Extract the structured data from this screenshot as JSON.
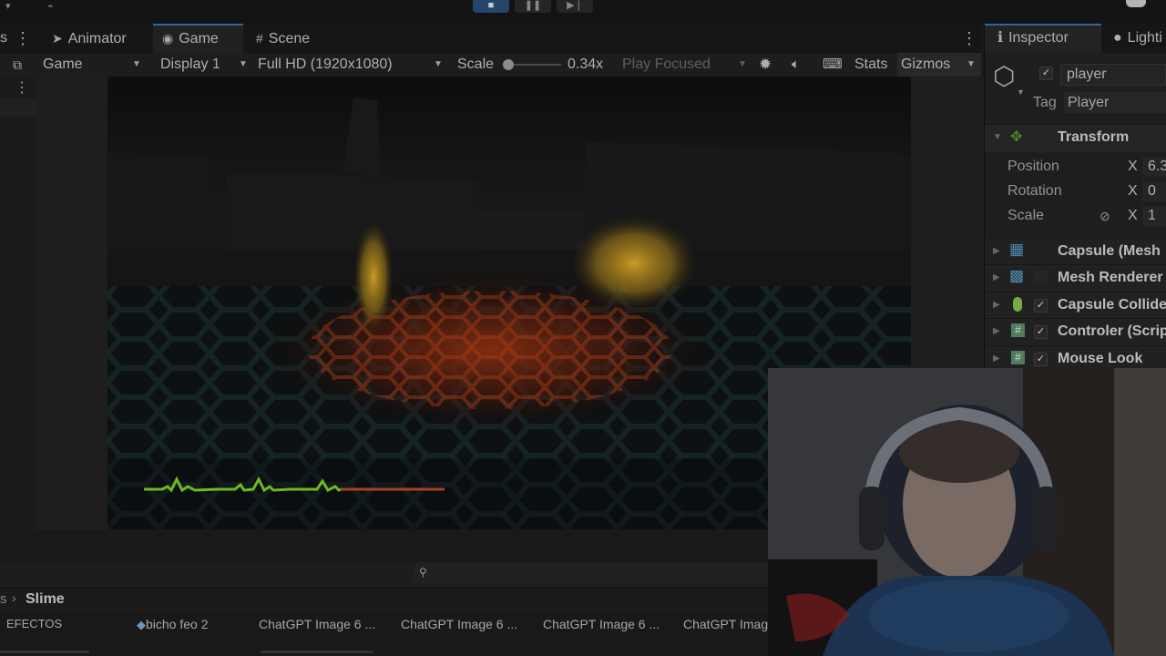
{
  "tabs": {
    "animator": "Animator",
    "game": "Game",
    "scene": "Scene"
  },
  "toolbar": {
    "view_select": "Game",
    "display": "Display 1",
    "resolution": "Full HD (1920x1080)",
    "scale_label": "Scale",
    "scale_value": "0.34x",
    "play_focused": "Play Focused",
    "stats": "Stats",
    "gizmos": "Gizmos"
  },
  "inspector": {
    "tabs": {
      "inspector": "Inspector",
      "lighting": "Lighti"
    },
    "object_name": "player",
    "tag_label": "Tag",
    "tag_value": "Player",
    "transform": {
      "title": "Transform",
      "rows": [
        {
          "label": "Position",
          "axis": "X",
          "value": "6.3"
        },
        {
          "label": "Rotation",
          "axis": "X",
          "value": "0"
        },
        {
          "label": "Scale",
          "axis": "X",
          "value": "1"
        }
      ]
    },
    "components": [
      {
        "name": "Capsule (Mesh",
        "icon": "mesh-filter-icon",
        "has_toggle": false
      },
      {
        "name": "Mesh Renderer",
        "icon": "mesh-renderer-icon",
        "has_toggle": false
      },
      {
        "name": "Capsule Collide",
        "icon": "capsule-collider-icon",
        "has_toggle": true
      },
      {
        "name": "Controler (Scrip",
        "icon": "script-icon",
        "has_toggle": true
      },
      {
        "name": "Mouse Look",
        "icon": "script-icon",
        "has_toggle": true
      }
    ]
  },
  "project": {
    "breadcrumb": "Slime",
    "assets": [
      {
        "name": "EFECTOS"
      },
      {
        "name": "bicho feo 2"
      },
      {
        "name": "ChatGPT Image 6 ..."
      },
      {
        "name": "ChatGPT Image 6 ..."
      },
      {
        "name": "ChatGPT Image 6 ..."
      },
      {
        "name": "ChatGPT Imag"
      }
    ]
  },
  "colors": {
    "accent": "#3a72b5",
    "transform_icon": "#4f9b3c",
    "component_icon": "#5aa0c8",
    "collider_icon": "#8bc34a",
    "health_line": "#7ed321",
    "health_missing": "#c0492b",
    "floor_glow": "#9b3413",
    "light_glow": "#d9a322"
  }
}
